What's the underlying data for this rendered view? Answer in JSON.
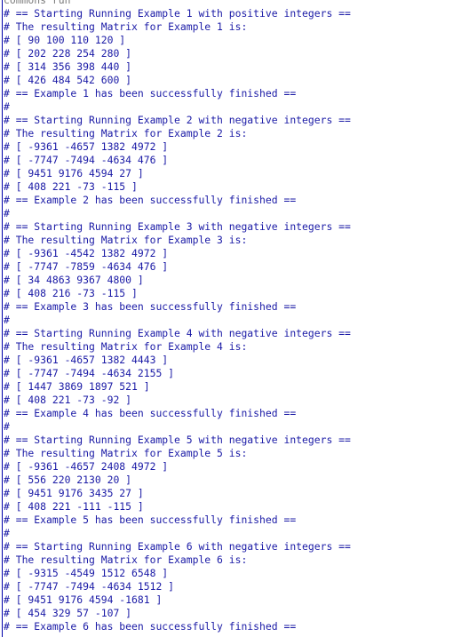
{
  "console": {
    "lines": [
      "commons run",
      "# == Starting Running Example 1 with positive integers ==",
      "# The resulting Matrix for Example 1 is:",
      "# [ 90 100 110 120 ]",
      "# [ 202 228 254 280 ]",
      "# [ 314 356 398 440 ]",
      "# [ 426 484 542 600 ]",
      "# == Example 1 has been successfully finished ==",
      "#",
      "# == Starting Running Example 2 with negative integers ==",
      "# The resulting Matrix for Example 2 is:",
      "# [ -9361 -4657 1382 4972 ]",
      "# [ -7747 -7494 -4634 476 ]",
      "# [ 9451 9176 4594 27 ]",
      "# [ 408 221 -73 -115 ]",
      "# == Example 2 has been successfully finished ==",
      "#",
      "# == Starting Running Example 3 with negative integers ==",
      "# The resulting Matrix for Example 3 is:",
      "# [ -9361 -4542 1382 4972 ]",
      "# [ -7747 -7859 -4634 476 ]",
      "# [ 34 4863 9367 4800 ]",
      "# [ 408 216 -73 -115 ]",
      "# == Example 3 has been successfully finished ==",
      "#",
      "# == Starting Running Example 4 with negative integers ==",
      "# The resulting Matrix for Example 4 is:",
      "# [ -9361 -4657 1382 4443 ]",
      "# [ -7747 -7494 -4634 2155 ]",
      "# [ 1447 3869 1897 521 ]",
      "# [ 408 221 -73 -92 ]",
      "# == Example 4 has been successfully finished ==",
      "#",
      "# == Starting Running Example 5 with negative integers ==",
      "# The resulting Matrix for Example 5 is:",
      "# [ -9361 -4657 2408 4972 ]",
      "# [ 556 220 2130 20 ]",
      "# [ 9451 9176 3435 27 ]",
      "# [ 408 221 -111 -115 ]",
      "# == Example 5 has been successfully finished ==",
      "#",
      "# == Starting Running Example 6 with negative integers ==",
      "# The resulting Matrix for Example 6 is:",
      "# [ -9315 -4549 1512 6548 ]",
      "# [ -7747 -7494 -4634 1512 ]",
      "# [ 9451 9176 4594 -1681 ]",
      "# [ 454 329 57 -107 ]",
      "# == Example 6 has been successfully finished =="
    ]
  }
}
